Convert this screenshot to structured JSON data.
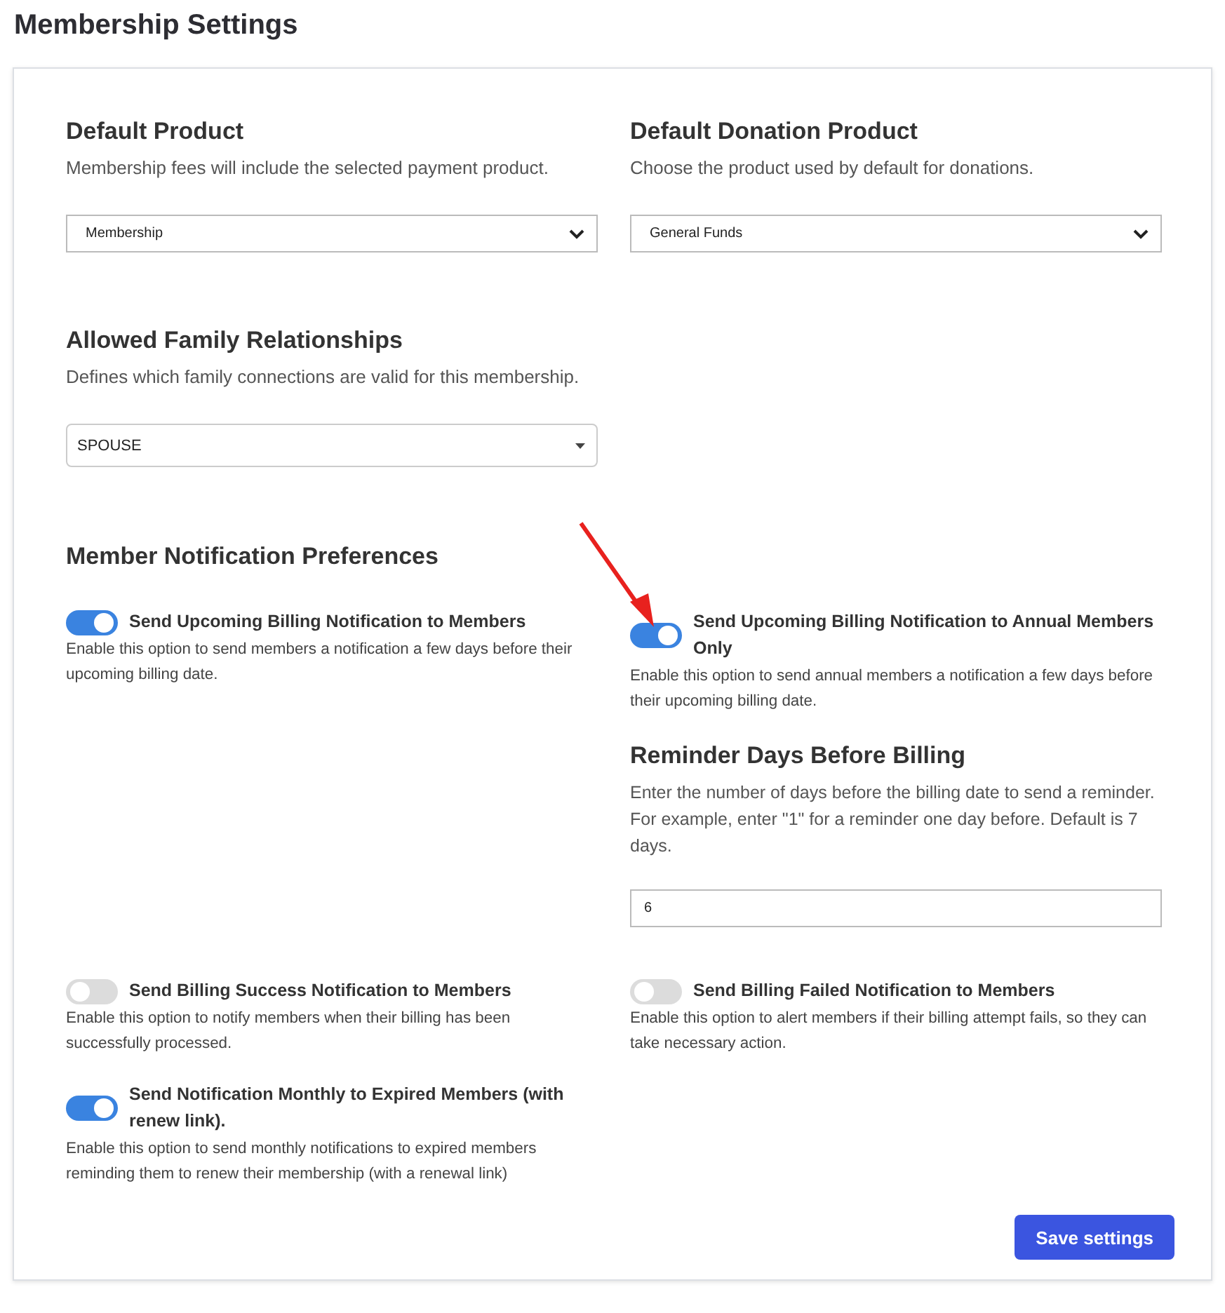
{
  "page_title": "Membership Settings",
  "product_fields": [
    {
      "label": "Default Product",
      "description": "Membership fees will include the selected payment product.",
      "value": "Membership",
      "kind": "native"
    },
    {
      "label": "Default Donation Product",
      "description": "Choose the product used by default for donations.",
      "value": "General Funds",
      "kind": "native"
    }
  ],
  "family_field": {
    "label": "Allowed Family Relationships",
    "description": "Defines which family connections are valid for this membership.",
    "value": "SPOUSE",
    "kind": "caret"
  },
  "notifications": {
    "title": "Member Notification Preferences",
    "toggles": [
      {
        "label": "Send Upcoming Billing Notification to Members",
        "description": "Enable this option to send members a notification a few days before their upcoming billing date.",
        "on": true
      },
      {
        "label": "Send Upcoming Billing Notification to Annual Members Only",
        "description": "Enable this option to send annual members a notification a few days before their upcoming billing date.",
        "on": true
      },
      {
        "label": "Send Billing Success Notification to Members",
        "description": "Enable this option to notify members when their billing has been successfully processed.",
        "on": false
      },
      {
        "label": "Send Billing Failed Notification to Members",
        "description": "Enable this option to alert members if their billing attempt fails, so they can take necessary action.",
        "on": false
      },
      {
        "label": "Send Notification Monthly to Expired Members (with renew link).",
        "description": "Enable this option to send monthly notifications to expired members reminding them to renew their membership (with a renewal link)",
        "on": true
      }
    ]
  },
  "reminder": {
    "label": "Reminder Days Before Billing",
    "description": "Enter the number of days before the billing date to send a reminder. For example, enter \"1\" for a reminder one day before. Default is 7 days.",
    "value": "6"
  },
  "save_button": "Save settings"
}
